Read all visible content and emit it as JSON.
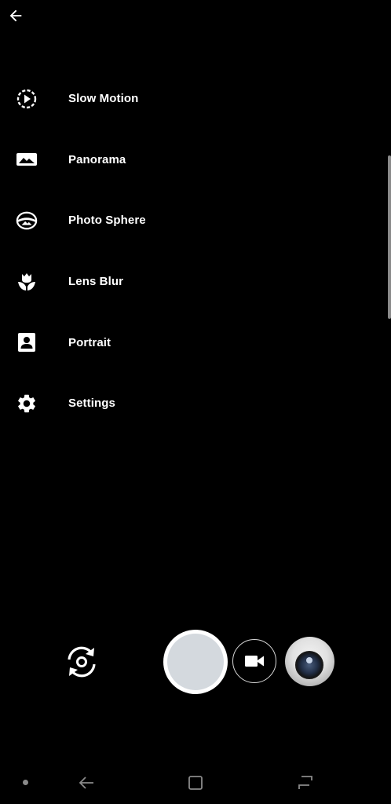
{
  "header": {
    "back_icon": "arrow-back-icon"
  },
  "menu": {
    "items": [
      {
        "label": "Slow Motion",
        "icon": "slow-motion-icon"
      },
      {
        "label": "Panorama",
        "icon": "panorama-icon"
      },
      {
        "label": "Photo Sphere",
        "icon": "photo-sphere-icon"
      },
      {
        "label": "Lens Blur",
        "icon": "lens-blur-icon"
      },
      {
        "label": "Portrait",
        "icon": "portrait-icon"
      },
      {
        "label": "Settings",
        "icon": "gear-icon"
      }
    ]
  },
  "controls": {
    "switch_camera_icon": "switch-camera-icon",
    "shutter_icon": "shutter-button",
    "video_icon": "video-camera-icon",
    "thumbnail_icon": "last-photo-thumbnail"
  },
  "navbar": {
    "back_icon": "nav-back-icon",
    "home_icon": "nav-home-icon",
    "recents_icon": "nav-recents-icon"
  },
  "colors": {
    "background": "#000000",
    "foreground": "#ffffff",
    "shutter_inner": "#d4d9de",
    "nav_icons": "#8a8a8a"
  }
}
